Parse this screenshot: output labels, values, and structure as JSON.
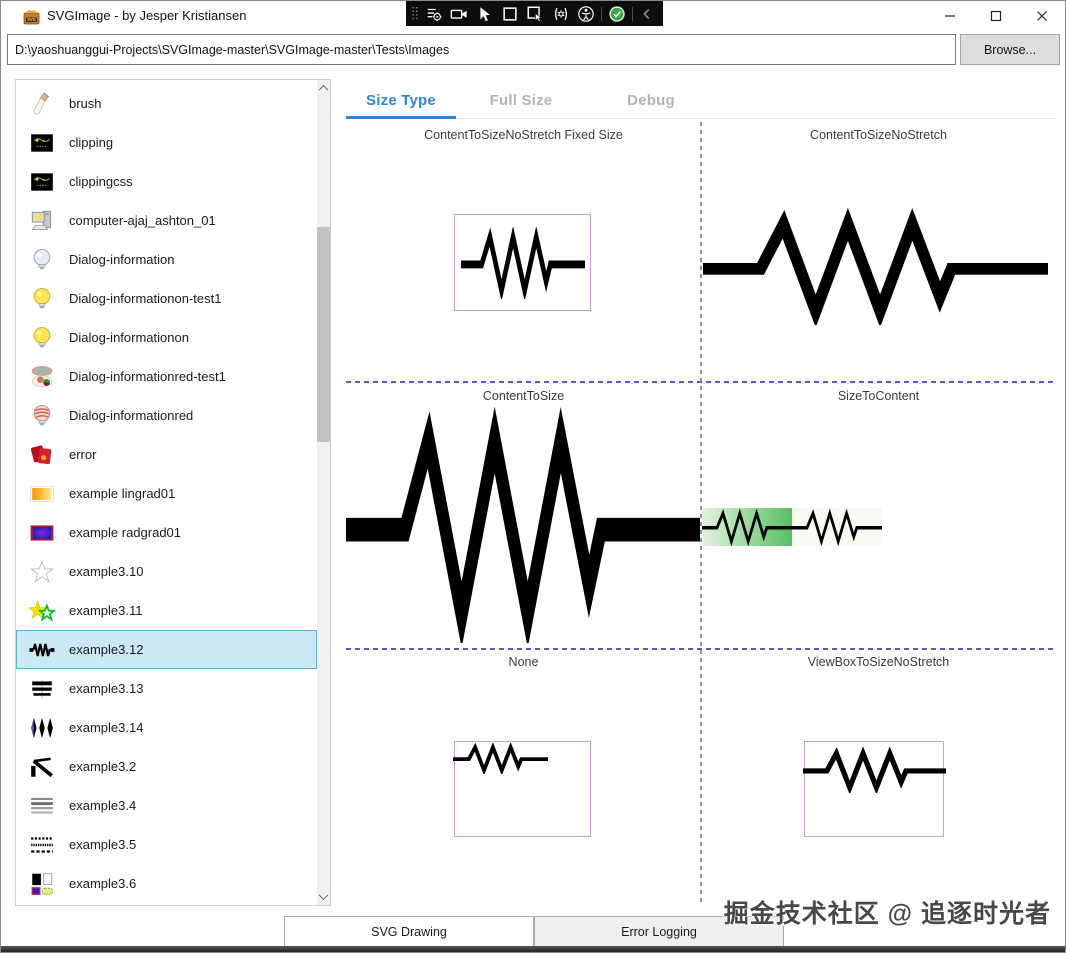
{
  "window": {
    "title": "SVGImage - by Jesper Kristiansen",
    "app_icon": "svg-gift-app-icon",
    "controls": [
      "minimize-button",
      "maximize-button",
      "close-button"
    ]
  },
  "overlay_toolbar": {
    "icons": [
      "grip-dots-icon",
      "capture-settings-icon",
      "video-camera-icon",
      "pointer-icon",
      "region-select-icon",
      "pointer-region-icon",
      "gear-brackets-icon",
      "accessibility-icon",
      "separator",
      "confirm-check-icon",
      "separator",
      "chevron-left-icon"
    ],
    "check_color": "#3aa647"
  },
  "address_bar": {
    "path": "D:\\yaoshuanggui-Projects\\SVGImage-master\\SVGImage-master\\Tests\\Images",
    "browse_label": "Browse..."
  },
  "sidebar": {
    "items": [
      {
        "label": "brush",
        "icon": "brush-icon",
        "selected": false
      },
      {
        "label": "clipping",
        "icon": "clipping-artwork-icon",
        "selected": false
      },
      {
        "label": "clippingcss",
        "icon": "clipping-artwork-icon",
        "selected": false
      },
      {
        "label": "computer-ajaj_ashton_01",
        "icon": "computer-icon",
        "selected": false
      },
      {
        "label": "Dialog-information",
        "icon": "lightbulb-gray-icon",
        "selected": false
      },
      {
        "label": "Dialog-informationon-test1",
        "icon": "lightbulb-yellow-icon",
        "selected": false
      },
      {
        "label": "Dialog-informationon",
        "icon": "lightbulb-yellow-icon",
        "selected": false
      },
      {
        "label": "Dialog-informationred-test1",
        "icon": "red-green-ellipses-icon",
        "selected": false
      },
      {
        "label": "Dialog-informationred",
        "icon": "lightbulb-red-icon",
        "selected": false
      },
      {
        "label": "error",
        "icon": "red-error-icon",
        "selected": false
      },
      {
        "label": "example lingrad01",
        "icon": "linear-gradient-icon",
        "selected": false
      },
      {
        "label": "example radgrad01",
        "icon": "radial-gradient-icon",
        "selected": false
      },
      {
        "label": "example3.10",
        "icon": "star-outline-icon",
        "selected": false
      },
      {
        "label": "example3.11",
        "icon": "two-stars-icon",
        "selected": false
      },
      {
        "label": "example3.12",
        "icon": "resistor-icon",
        "selected": true
      },
      {
        "label": "example3.13",
        "icon": "black-bars-icon",
        "selected": false
      },
      {
        "label": "example3.14",
        "icon": "spikes-icon",
        "selected": false
      },
      {
        "label": "example3.2",
        "icon": "lines-angle-icon",
        "selected": false
      },
      {
        "label": "example3.4",
        "icon": "gray-lines-icon",
        "selected": false
      },
      {
        "label": "example3.5",
        "icon": "dashed-lines-icon",
        "selected": false
      },
      {
        "label": "example3.6",
        "icon": "four-squares-icon",
        "selected": false
      }
    ]
  },
  "tabs": [
    {
      "label": "Size Type",
      "active": true
    },
    {
      "label": "Full Size",
      "active": false
    },
    {
      "label": "Debug",
      "active": false
    }
  ],
  "grid": {
    "cells": [
      {
        "label": "ContentToSizeNoStretch Fixed Size"
      },
      {
        "label": "ContentToSizeNoStretch"
      },
      {
        "label": "ContentToSize"
      },
      {
        "label": "SizeToContent"
      },
      {
        "label": "None"
      },
      {
        "label": "ViewBoxToSizeNoStretch"
      }
    ]
  },
  "bottom_tabs": [
    {
      "label": "SVG Drawing",
      "active": true
    },
    {
      "label": "Error Logging",
      "active": false
    }
  ],
  "watermark": "掘金技术社区 @ 追逐时光者",
  "colors": {
    "accent_blue": "#2e86d4",
    "selection_bg": "#cbe8f6",
    "selection_border": "#58b2dd",
    "grid_dash_blue": "#4f5fc8",
    "grid_dash_yellow": "#ffffd2",
    "cell_box_border": "#c9a0c9",
    "gradient_green": "#55c162",
    "check_green": "#3aa647"
  }
}
